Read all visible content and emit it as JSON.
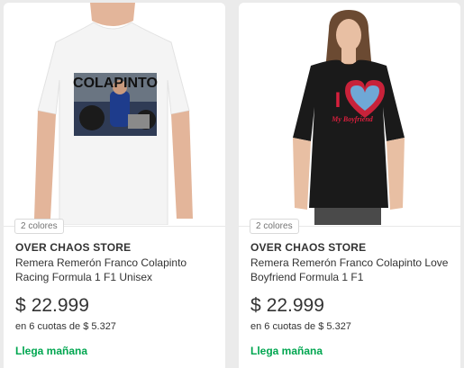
{
  "products": [
    {
      "colors_badge": "2 colores",
      "store": "OVER CHAOS STORE",
      "title": "Remera Remerón Franco Colapinto Racing Formula 1 F1 Unisex",
      "price": {
        "currency": "$",
        "amount": "22.999"
      },
      "installments": "en 6 cuotas de $ 5.327",
      "shipping": "Llega mañana",
      "image": {
        "print_text": "COLAPINTO",
        "shirt_color": "#ffffff"
      }
    },
    {
      "colors_badge": "2 colores",
      "store": "OVER CHAOS STORE",
      "title": "Remera Remerón Franco Colapinto Love Boyfriend Formula 1 F1",
      "price": {
        "currency": "$",
        "amount": "22.999"
      },
      "installments": "en 6 cuotas de $ 5.327",
      "shipping": "Llega mañana",
      "image": {
        "print_text_big": "I",
        "print_text_small": "My Boyfriend",
        "shirt_color": "#1a1a1a"
      }
    }
  ],
  "colors": {
    "background": "#ebebeb",
    "card": "#ffffff",
    "text": "#333333",
    "muted": "#737373",
    "shipping_green": "#00a650"
  }
}
